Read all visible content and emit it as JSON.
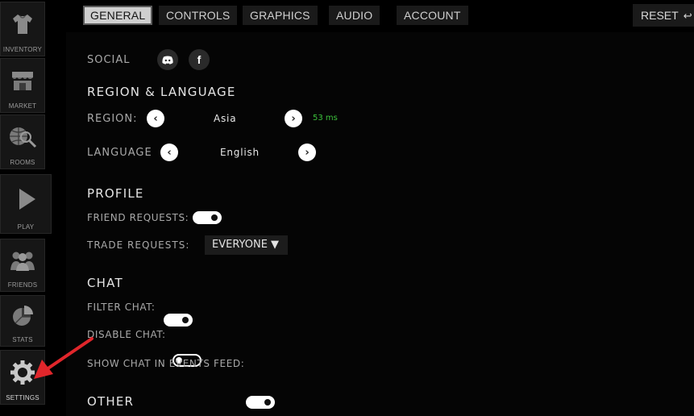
{
  "sidebar": {
    "items": [
      {
        "label": "INVENTORY",
        "icon": "shirt-icon"
      },
      {
        "label": "MARKET",
        "icon": "market-stall-icon"
      },
      {
        "label": "ROOMS",
        "icon": "globe-search-icon"
      },
      {
        "label": "PLAY",
        "icon": "play-icon"
      },
      {
        "label": "FRIENDS",
        "icon": "friends-icon"
      },
      {
        "label": "STATS",
        "icon": "pie-chart-icon"
      },
      {
        "label": "SETTINGS",
        "icon": "gear-icon"
      }
    ]
  },
  "tabs": [
    {
      "label": "GENERAL",
      "active": true
    },
    {
      "label": "CONTROLS",
      "active": false
    },
    {
      "label": "GRAPHICS",
      "active": false
    },
    {
      "label": "AUDIO",
      "active": false
    },
    {
      "label": "ACCOUNT",
      "active": false
    }
  ],
  "reset": {
    "label": "RESET",
    "icon": "undo-icon"
  },
  "social": {
    "label": "SOCIAL",
    "icons": [
      "discord-icon",
      "facebook-icon"
    ]
  },
  "region_language": {
    "title": "REGION & LANGUAGE",
    "region_label": "REGION:",
    "region_value": "Asia",
    "region_ping": "53 ms",
    "language_label": "LANGUAGE",
    "language_value": "English"
  },
  "profile": {
    "title": "PROFILE",
    "friend_requests_label": "FRIEND REQUESTS:",
    "friend_requests_on": true,
    "trade_requests_label": "TRADE REQUESTS:",
    "trade_requests_value": "EVERYONE ▼"
  },
  "chat": {
    "title": "CHAT",
    "filter_chat_label": "FILTER CHAT:",
    "filter_chat_on": true,
    "disable_chat_label": "DISABLE CHAT:",
    "disable_chat_on": false,
    "show_chat_label": "SHOW CHAT IN EVENTS FEED:",
    "show_chat_on": true
  },
  "other": {
    "title": "OTHER"
  },
  "colors": {
    "ping_green": "#3cc23c",
    "annotation_red": "#e0262b",
    "background": "#000000"
  }
}
